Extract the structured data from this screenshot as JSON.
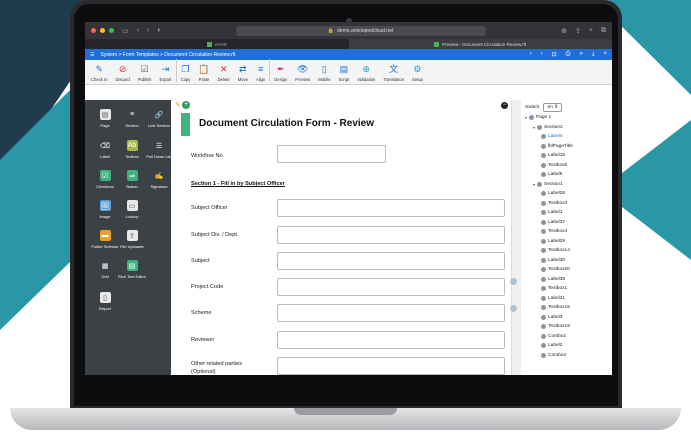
{
  "browser": {
    "url": "demo.antelopedcloud.net",
    "tab1": "eSMB",
    "tab2": "Preview - Document Circulation Review.rft"
  },
  "appbar": {
    "menu_icon": "hamburger-icon",
    "breadcrumb": "System > Form Templates > Document Circulation Review.rft"
  },
  "toolbar": [
    {
      "label": "Check In",
      "icon": "pencil-icon",
      "color": "#1e6fd9"
    },
    {
      "label": "Discard",
      "icon": "no-entry-icon",
      "color": "#e0302a"
    },
    {
      "label": "Publish",
      "icon": "checkbox-icon",
      "color": "#555555"
    },
    {
      "label": "Export",
      "icon": "export-icon",
      "color": "#1e6fd9"
    },
    {
      "label": "Copy",
      "icon": "copy-icon",
      "color": "#1e6fd9"
    },
    {
      "label": "Paste",
      "icon": "clipboard-icon",
      "color": "#1e6fd9"
    },
    {
      "label": "Delete",
      "icon": "x-icon",
      "color": "#e0302a"
    },
    {
      "label": "Move",
      "icon": "move-icon",
      "color": "#1e6fd9"
    },
    {
      "label": "Align",
      "icon": "align-icon",
      "color": "#1e6fd9"
    },
    {
      "label": "Design",
      "icon": "pen-icon",
      "color": "#b8306e"
    },
    {
      "label": "Preview",
      "icon": "eye-icon",
      "color": "#1e6fd9"
    },
    {
      "label": "Mobile",
      "icon": "mobile-icon",
      "color": "#1e6fd9"
    },
    {
      "label": "Script",
      "icon": "script-icon",
      "color": "#1e6fd9"
    },
    {
      "label": "Validation",
      "icon": "plus-circle-icon",
      "color": "#1e9bd9"
    },
    {
      "label": "Translation",
      "icon": "translate-icon",
      "color": "#1e6fd9"
    },
    {
      "label": "Setup",
      "icon": "gear-icon",
      "color": "#1e9bd9"
    }
  ],
  "palette": [
    {
      "label": "Page",
      "icon": "page-icon",
      "color": "#e8e8e8"
    },
    {
      "label": "Section",
      "icon": "section-icon",
      "color": "#3c4146"
    },
    {
      "label": "Link Section",
      "icon": "link-icon",
      "color": "#3c4146"
    },
    {
      "label": "Label",
      "icon": "label-icon",
      "color": "#3c4146"
    },
    {
      "label": "Textbox",
      "icon": "textbox-icon",
      "color": "#a8b84a"
    },
    {
      "label": "Pull Down List",
      "icon": "list-icon",
      "color": "#3c4146"
    },
    {
      "label": "Checkbox",
      "icon": "checkbox-icon",
      "color": "#3fb37f"
    },
    {
      "label": "Button",
      "icon": "button-icon",
      "color": "#3fb37f"
    },
    {
      "label": "Signature",
      "icon": "signature-icon",
      "color": "#3c4146"
    },
    {
      "label": "Image",
      "icon": "image-icon",
      "color": "#5a9ed6"
    },
    {
      "label": "Lookup",
      "icon": "lookup-icon",
      "color": "#e8e8e8"
    },
    {
      "label": "Folder Selector",
      "icon": "folder-icon",
      "color": "#e8a020"
    },
    {
      "label": "File Uploader",
      "icon": "upload-icon",
      "color": "#e8e8e8"
    },
    {
      "label": "Grid",
      "icon": "grid-icon",
      "color": "#3c4146"
    },
    {
      "label": "Rich Text Editor",
      "icon": "editor-icon",
      "color": "#3fb37f"
    },
    {
      "label": "Report",
      "icon": "report-icon",
      "color": "#e8e8e8"
    }
  ],
  "form": {
    "title": "Document Circulation Form - Review",
    "workflow_label": "Workflow No.",
    "section_title": "Section 1 - Fill in by Subject Officer",
    "fields": [
      {
        "label": "Subject Officer"
      },
      {
        "label": "Subject Div. / Dept."
      },
      {
        "label": "Subject"
      },
      {
        "label": "Project Code"
      },
      {
        "label": "Scheme"
      },
      {
        "label": "Reviewer"
      },
      {
        "label": "Other related parties (Optional)"
      }
    ]
  },
  "tree": {
    "switch_label": "Switch:",
    "switch_value": "en",
    "items": [
      {
        "text": "Page 1",
        "level": 0,
        "caret": true
      },
      {
        "text": "Section2",
        "level": 1,
        "caret": true
      },
      {
        "text": "Label4",
        "level": 2,
        "caret": false,
        "selected": true
      },
      {
        "text": "lblPageTitle",
        "level": 2
      },
      {
        "text": "Label15",
        "level": 2
      },
      {
        "text": "Textbox6",
        "level": 2
      },
      {
        "text": "Label6",
        "level": 2
      },
      {
        "text": "Section1",
        "level": 1,
        "caret": true
      },
      {
        "text": "Label26",
        "level": 2
      },
      {
        "text": "Textbox3",
        "level": 2
      },
      {
        "text": "Label1",
        "level": 2
      },
      {
        "text": "Label37",
        "level": 2
      },
      {
        "text": "Textbox4",
        "level": 2
      },
      {
        "text": "Label29",
        "level": 2
      },
      {
        "text": "Textbox14",
        "level": 2
      },
      {
        "text": "Label30",
        "level": 2
      },
      {
        "text": "Textbox20",
        "level": 2
      },
      {
        "text": "Label38",
        "level": 2
      },
      {
        "text": "Textbox1",
        "level": 2
      },
      {
        "text": "Label21",
        "level": 2
      },
      {
        "text": "Textbox15",
        "level": 2
      },
      {
        "text": "Label3",
        "level": 2
      },
      {
        "text": "Textbox19",
        "level": 2
      },
      {
        "text": "Combo1",
        "level": 2
      },
      {
        "text": "Label2",
        "level": 2
      },
      {
        "text": "Combo2",
        "level": 2
      }
    ]
  }
}
